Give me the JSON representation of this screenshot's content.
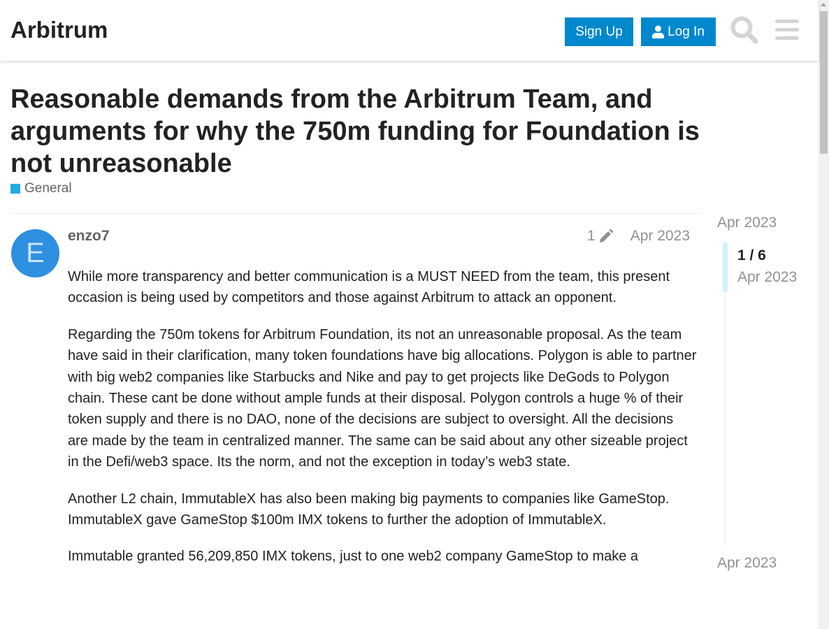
{
  "header": {
    "logo": "Arbitrum",
    "signup": "Sign Up",
    "login": "Log In"
  },
  "topic": {
    "title": "Reasonable demands from the Arbitrum Team, and arguments for why the 750m funding for Foundation is not unreasonable",
    "category": "General",
    "category_color": "#25aae1"
  },
  "post": {
    "avatar_letter": "E",
    "username": "enzo7",
    "edits": "1",
    "date": "Apr 2023",
    "paragraphs": [
      "While more transparency and better communication is a MUST NEED from the team, this present occasion is being used by competitors and those against Arbitrum to attack an opponent.",
      "Regarding the 750m tokens for Arbitrum Foundation, its not an unreasonable proposal. As the team have said in their clarification, many token foundations have big allocations. Polygon is able to partner with big web2 companies like Starbucks and Nike and pay to get projects like DeGods to Polygon chain. These cant be done without ample funds at their disposal. Polygon controls a huge % of their token supply and there is no DAO, none of the decisions are subject to oversight. All the decisions are made by the team in centralized manner. The same can be said about any other sizeable project in the Defi/web3 space. Its the norm, and not the exception in today’s web3 state.",
      "Another L2 chain, ImmutableX has also been making big payments to companies like GameStop. ImmutableX gave GameStop $100m IMX tokens to further the adoption of ImmutableX.",
      "Immutable granted 56,209,850 IMX tokens, just to one web2 company GameStop to make a"
    ]
  },
  "timeline": {
    "start": "Apr 2023",
    "count": "1 / 6",
    "current_date": "Apr 2023",
    "end": "Apr 2023",
    "progress": "1/6"
  },
  "colors": {
    "primary": "#0088cc",
    "avatar": "#2e90e0"
  }
}
